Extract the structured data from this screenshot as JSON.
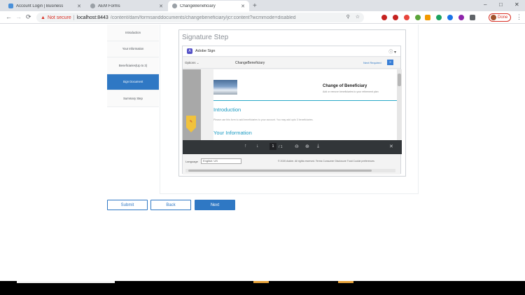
{
  "browser": {
    "tabs": [
      {
        "title": "Account Login | Business",
        "color": "#4a90d9"
      },
      {
        "title": "AEM Forms",
        "color": "#9aa0a6"
      },
      {
        "title": "ChangeBeneficiary",
        "color": "#9aa0a6"
      }
    ],
    "new_tab": "+",
    "window_controls": [
      "–",
      "□",
      "✕"
    ],
    "nav": {
      "back": "←",
      "forward": "→",
      "reload": "⟳"
    },
    "security_label": "Not secure",
    "url_separator": "|",
    "url_host": "localhost:8443",
    "url_path": "/content/dam/formsanddocuments/changebeneficiary/jcr:content?wcmmode=disabled",
    "omnibox_icons": [
      "⚲",
      "☆"
    ],
    "extension_colors": [
      "#c5221f",
      "#c5221f",
      "#e8453c",
      "#5aa43a",
      "#f29900",
      "#1aa260",
      "#1a73e8",
      "#8e24aa",
      "#5f6368"
    ],
    "profile_label": "Done",
    "menu_icon": "⋮"
  },
  "wizard": {
    "steps": [
      {
        "label": "Introduction",
        "active": false
      },
      {
        "label": "Your Information",
        "active": false
      },
      {
        "label": "Beneficiaries(Up to 3)",
        "active": false
      },
      {
        "label": "Sign Document",
        "active": true
      },
      {
        "label": "Summary Step",
        "active": false
      }
    ]
  },
  "signature": {
    "title": "Signature Step",
    "adobe": {
      "brand": "Adobe Sign",
      "logo_glyph": "A",
      "help_icon": "ⓘ ▾",
      "options": "Options ⌄",
      "document_name": "ChangeBeneficiary",
      "next_required": "Next Required",
      "next_arrow": "»",
      "flag_glyph": "✎",
      "doc_heading": "Change of Beneficiary",
      "doc_subheading": "Add or remove beneficiaries to your retirement plan",
      "intro_heading": "Introduction",
      "intro_text": "Please use this form to add beneficiaries to your account. You may add upto 3 beneficiaries.",
      "info_heading": "Your Information",
      "pdf_toolbar": {
        "up": "↑",
        "down": "↓",
        "page": "1",
        "pages": "/ 1",
        "zoom_out": "⊖",
        "zoom_in": "⊕",
        "download": "⤓",
        "close": "✕"
      },
      "footer": {
        "language_label": "Language",
        "language_value": "English: US",
        "links": "© 2020 Adobe. All rights reserved.    Terms    Consumer Disclosure    Trust    Cookie preferences"
      }
    }
  },
  "buttons": {
    "submit": "Submit",
    "back": "Back",
    "next": "Next"
  },
  "taskbar": {
    "accent_colors": [
      "#f5f5f5",
      "#e8a33c",
      "#e8a33c"
    ]
  }
}
